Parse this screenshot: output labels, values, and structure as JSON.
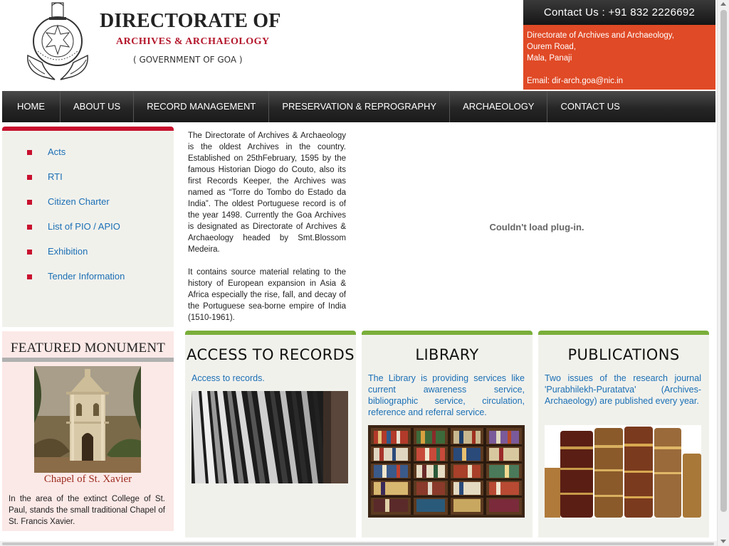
{
  "header": {
    "title_main": "DIRECTORATE OF",
    "title_sub": "ARCHIVES & ARCHAEOLOGY",
    "title_gov": "( GOVERNMENT OF GOA )",
    "emblem_icon": "goa-government-emblem-icon"
  },
  "contact": {
    "phone_line": "Contact Us : +91 832 2226692",
    "address_lines": [
      "Directorate of Archives and Archaeology,",
      "Ourem Road,",
      "Mala, Panaji"
    ],
    "email_line": "Email: dir-arch.goa@nic.in"
  },
  "nav": {
    "items": [
      "HOME",
      "ABOUT US",
      "RECORD MANAGEMENT",
      "PRESERVATION & REPROGRAPHY",
      "ARCHAEOLOGY",
      "CONTACT US"
    ]
  },
  "sidebar": {
    "links": [
      "Acts",
      "RTI",
      "Citizen Charter",
      "List of PIO / APIO",
      "Exhibition",
      "Tender Information"
    ]
  },
  "intro": {
    "para1": "The Directorate of Archives & Archaeology is the oldest Archives in the country. Established on 25thFebruary, 1595 by the famous Historian Diogo do Couto, also its first Records Keeper, the Archives was named as “Torre do Tombo do Estado da India”. The oldest Portuguese record is of the year 1498. Currently the Goa Archives is designated as Directorate of Archives & Archaeology headed by Smt.Blossom Medeira.",
    "para2": "It contains source material relating to the history of European expansion in Asia & Africa especially the rise, fall, and decay of the Portuguese sea-borne empire of India (1510-1961)."
  },
  "plugin": {
    "message": "Couldn't load plug-in."
  },
  "featured": {
    "heading": "FEATURED MONUMENT",
    "name": "Chapel of St. Xavier",
    "description": "In the area of the extinct College of St. Paul, stands the small traditional Chapel of St. Francis Xavier."
  },
  "cards": {
    "access": {
      "title": "ACCESS TO RECORDS",
      "text": "Access to records."
    },
    "library": {
      "title": "LIBRARY",
      "text": "The Library is providing services like current awareness service, bibliographic service, circulation, reference and referral service."
    },
    "publications": {
      "title": "PUBLICATIONS",
      "text": "Two issues of the research journal 'Purabhilekh-Puratatva' (Archives-Archaeology) are published every year."
    }
  },
  "colors": {
    "accent_red": "#c8102e",
    "contact_orange": "#e04a26",
    "card_green": "#7aae3a",
    "link_blue": "#1a6fb5"
  }
}
